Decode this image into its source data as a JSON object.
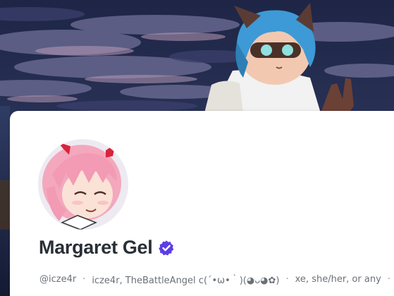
{
  "profile": {
    "display_name": "Margaret Gel",
    "verified_icon": "verified-badge-icon",
    "handle": "@icze4r",
    "aliases": "icze4r, TheBattleAngel c(´•ω•｀)(◕ᴗ◕✿)",
    "pronouns": "xe, she/her, or any",
    "separator": "·"
  },
  "colors": {
    "card_background": "#ffffff",
    "name_text": "#2a2f36",
    "meta_text": "#6b7078",
    "verified_badge": "#5b3ee8",
    "banner_sky": "#242c4e"
  },
  "images": {
    "banner": "night sky with clouds and ocean, anime cat-eared character with blue hair and goggles",
    "avatar": "anime girl with pink hair and red ribbons, eyes closed smiling"
  }
}
